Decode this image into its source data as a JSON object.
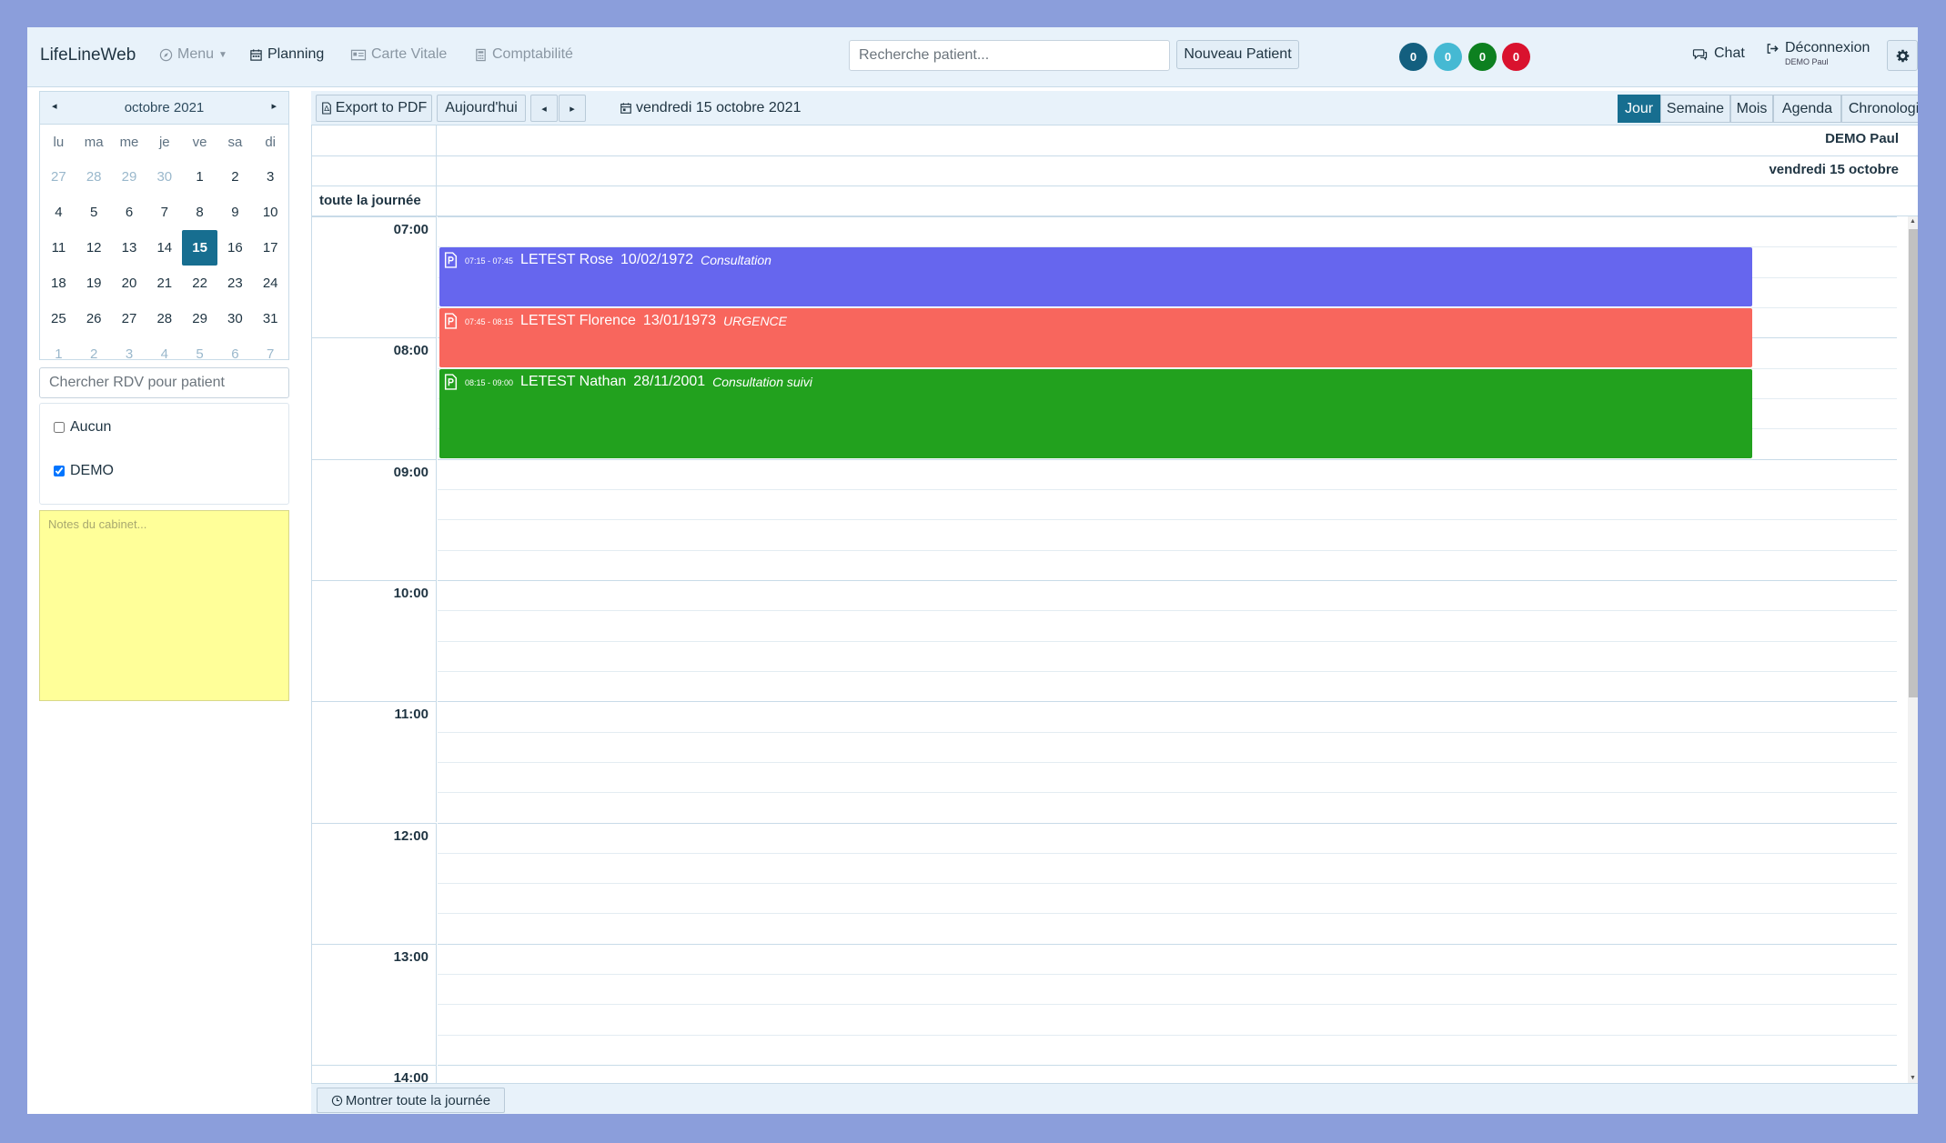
{
  "navbar": {
    "brand": "LifeLineWeb",
    "menu_label": "Menu",
    "planning_label": "Planning",
    "carte_vitale_label": "Carte Vitale",
    "comptabilite_label": "Comptabilité",
    "search_placeholder": "Recherche patient...",
    "new_patient_label": "Nouveau Patient",
    "badges": [
      {
        "value": "0",
        "color": "#135f7f"
      },
      {
        "value": "0",
        "color": "#45b9d3"
      },
      {
        "value": "0",
        "color": "#0d8020"
      },
      {
        "value": "0",
        "color": "#d9122e"
      }
    ],
    "chat_label": "Chat",
    "logout_label": "Déconnexion",
    "logout_user": "DEMO Paul"
  },
  "mini_calendar": {
    "title": "octobre 2021",
    "prev_icon": "◂",
    "next_icon": "▸",
    "weekdays": [
      "lu",
      "ma",
      "me",
      "je",
      "ve",
      "sa",
      "di"
    ],
    "weeks": [
      [
        "27",
        "28",
        "29",
        "30",
        "1",
        "2",
        "3"
      ],
      [
        "4",
        "5",
        "6",
        "7",
        "8",
        "9",
        "10"
      ],
      [
        "11",
        "12",
        "13",
        "14",
        "15",
        "16",
        "17"
      ],
      [
        "18",
        "19",
        "20",
        "21",
        "22",
        "23",
        "24"
      ],
      [
        "25",
        "26",
        "27",
        "28",
        "29",
        "30",
        "31"
      ],
      [
        "1",
        "2",
        "3",
        "4",
        "5",
        "6",
        "7"
      ]
    ],
    "selected_day": "15"
  },
  "sidebar": {
    "rdv_search_placeholder": "Chercher RDV pour patient",
    "filters": [
      {
        "label": "Aucun",
        "checked": false
      },
      {
        "label": "DEMO",
        "checked": true
      }
    ],
    "notes_placeholder": "Notes du cabinet..."
  },
  "toolbar": {
    "export_label": "Export to PDF",
    "today_label": "Aujourd'hui",
    "prev_icon": "◂",
    "next_icon": "▸",
    "current_date": "vendredi 15 octobre 2021",
    "views": [
      {
        "label": "Jour",
        "active": true
      },
      {
        "label": "Semaine",
        "active": false
      },
      {
        "label": "Mois",
        "active": false
      },
      {
        "label": "Agenda",
        "active": false
      },
      {
        "label": "Chronologie",
        "active": false
      }
    ]
  },
  "calendar": {
    "resource": "DEMO Paul",
    "day_header": "vendredi 15 octobre",
    "allday_label": "toute la journée",
    "hours": [
      "07:00",
      "08:00",
      "09:00",
      "10:00",
      "11:00",
      "12:00",
      "13:00",
      "14:00"
    ],
    "events": [
      {
        "time": "07:15 - 07:45",
        "name": "LETEST Rose",
        "dob": "10/02/1972",
        "motif": "Consultation",
        "color": "#6666ee",
        "start": "07:15",
        "end": "07:45"
      },
      {
        "time": "07:45 - 08:15",
        "name": "LETEST Florence",
        "dob": "13/01/1973",
        "motif": "URGENCE",
        "color": "#f8665d",
        "start": "07:45",
        "end": "08:15"
      },
      {
        "time": "08:15 - 09:00",
        "name": "LETEST Nathan",
        "dob": "28/11/2001",
        "motif": "Consultation suivi",
        "color": "#22a11e",
        "start": "08:15",
        "end": "09:00"
      }
    ],
    "show_all_label": "Montrer toute la journée"
  }
}
